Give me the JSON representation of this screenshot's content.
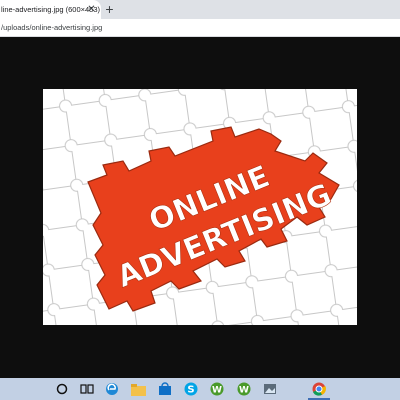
{
  "browser": {
    "tab_title": "line-advertising.jpg (600×453)",
    "tab_close_glyph": "✕",
    "new_tab_glyph": "+",
    "url": "/uploads/online-advertising.jpg"
  },
  "image": {
    "line1": "ONLINE",
    "line2": "ADVERTISING",
    "colors": {
      "background": "#ffffff",
      "puzzle_piece": "#ffffff",
      "piece_outline": "#c7c7c7",
      "inner_panel": "#e8401c",
      "text": "#ffffff"
    }
  },
  "taskbar": {
    "items": [
      {
        "icon": "cortana-circle-icon"
      },
      {
        "icon": "task-view-icon"
      },
      {
        "icon": "edge-icon"
      },
      {
        "icon": "file-explorer-icon"
      },
      {
        "icon": "store-icon"
      },
      {
        "icon": "skype-icon"
      },
      {
        "icon": "word-icon"
      },
      {
        "icon": "word-icon"
      },
      {
        "icon": "photos-icon"
      },
      {
        "icon": "chrome-icon"
      }
    ]
  }
}
